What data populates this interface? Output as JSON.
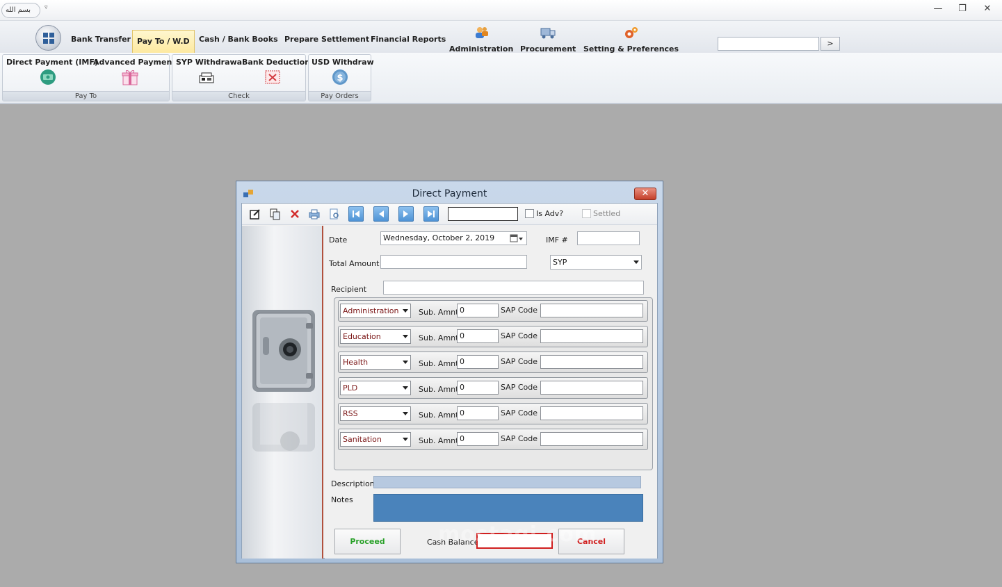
{
  "titlebar": {
    "qat_label": "بسم الله",
    "qat_arrow": "▿",
    "minimize": "—",
    "restore": "❐",
    "close": "✕"
  },
  "tabs": [
    {
      "label": "Bank Transfer"
    },
    {
      "label": "Pay To / W.D",
      "active": true
    },
    {
      "label": "Cash  / Bank Books"
    },
    {
      "label": "Prepare Settlement"
    },
    {
      "label": "Financial Reports"
    },
    {
      "label": "Administration",
      "icon": "administrator-icon"
    },
    {
      "label": "Procurement",
      "icon": "truck-icon"
    },
    {
      "label": "Setting & Preferences",
      "icon": "gears-icon"
    }
  ],
  "search": {
    "value": "",
    "go_label": ">"
  },
  "ribbon": {
    "groups": [
      {
        "label": "Pay To",
        "buttons": [
          {
            "label": "Direct Payment (IMF)",
            "icon": "money-coin-icon"
          },
          {
            "label": "Advanced Payment",
            "icon": "gift-icon"
          }
        ]
      },
      {
        "label": "Check",
        "buttons": [
          {
            "label": "SYP Withdrawal",
            "icon": "cash-stack-icon"
          },
          {
            "label": "Bank Deduction",
            "icon": "bank-deduction-icon"
          }
        ]
      },
      {
        "label": "Pay Orders",
        "buttons": [
          {
            "label": "USD Withdraw",
            "icon": "dollar-coin-icon"
          }
        ]
      }
    ]
  },
  "modal": {
    "title": "Direct Payment",
    "close_label": "✕",
    "toolbar": {
      "icons": [
        "edit-icon",
        "copy-icon",
        "delete-icon",
        "print-icon",
        "preview-icon",
        "first-record-icon",
        "previous-record-icon",
        "next-record-icon",
        "last-record-icon"
      ],
      "record_value": "",
      "is_adv_label": "Is Adv?",
      "is_adv_checked": false,
      "settled_label": "Settled",
      "settled_checked": false
    },
    "form": {
      "date_label": "Date",
      "date_value": "Wednesday,   October     2, 2019",
      "imf_label": "IMF #",
      "imf_value": "",
      "total_amount_label": "Total Amount",
      "total_amount_value": "",
      "currency_value": "SYP",
      "recipient_label": "Recipient",
      "recipient_value": "",
      "sub_amount_label": "Sub. Amnt",
      "sap_code_label": "SAP Code",
      "allocations": [
        {
          "category": "Administration",
          "sub_amount": "0",
          "sap_code": ""
        },
        {
          "category": "Education",
          "sub_amount": "0",
          "sap_code": ""
        },
        {
          "category": "Health",
          "sub_amount": "0",
          "sap_code": ""
        },
        {
          "category": "PLD",
          "sub_amount": "0",
          "sap_code": ""
        },
        {
          "category": "RSS",
          "sub_amount": "0",
          "sap_code": ""
        },
        {
          "category": "Sanitation",
          "sub_amount": "0",
          "sap_code": ""
        }
      ],
      "description_label": "Description",
      "description_value": "",
      "notes_label": "Notes",
      "notes_value": "",
      "proceed_label": "Proceed",
      "cash_balance_label": "Cash Balance",
      "cash_balance_value": "",
      "cancel_label": "Cancel"
    }
  },
  "watermark": "mostaqi.com",
  "colors": {
    "active_tab": "#fde9a0",
    "proceed_text": "#2aa12a",
    "cancel_text": "#d01f1f",
    "category_text": "#7a1515",
    "notes_fill": "#4a83bb",
    "desktop_background": "#ababab"
  }
}
